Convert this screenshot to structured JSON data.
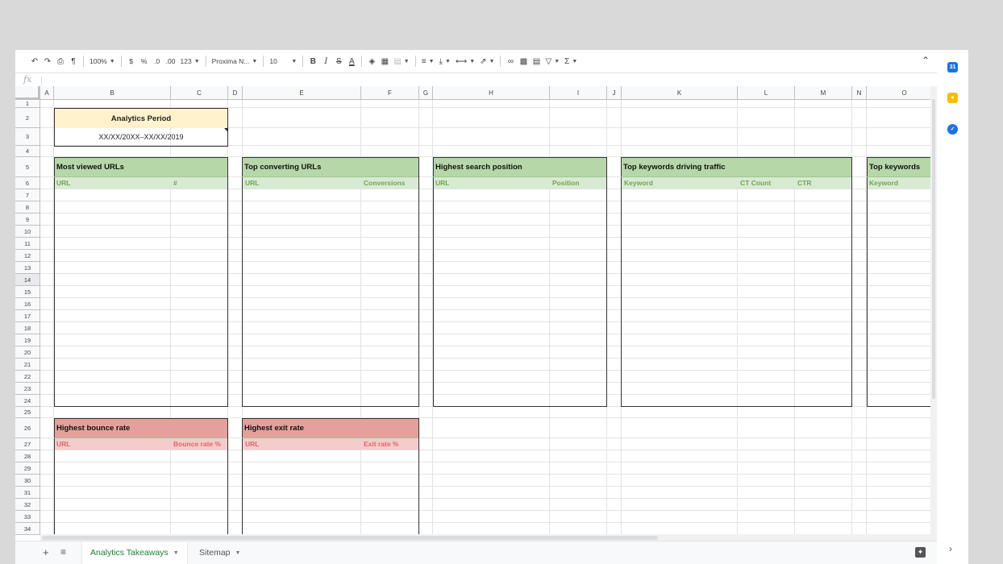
{
  "toolbar": {
    "zoom": "100%",
    "currency": "$",
    "percent": "%",
    "decrease_decimal": ".0",
    "increase_decimal": ".00",
    "more_formats": "123",
    "font": "Proxima N...",
    "font_size": "10",
    "bold": "B",
    "italic": "I",
    "strike": "S",
    "text_color": "A",
    "functions": "Σ"
  },
  "formula_bar": {
    "fx_label": "fx"
  },
  "columns": [
    "A",
    "B",
    "C",
    "D",
    "E",
    "F",
    "G",
    "H",
    "I",
    "J",
    "K",
    "L",
    "M",
    "N",
    "O"
  ],
  "rows": [
    "1",
    "2",
    "3",
    "4",
    "5",
    "6",
    "7",
    "8",
    "9",
    "10",
    "11",
    "12",
    "13",
    "14",
    "15",
    "16",
    "17",
    "18",
    "19",
    "20",
    "21",
    "22",
    "23",
    "24",
    "25",
    "26",
    "27",
    "28",
    "29",
    "30",
    "31",
    "32",
    "33",
    "34"
  ],
  "analytics_period": {
    "title": "Analytics Period",
    "value": "XX/XX/20XX–XX/XX/2019"
  },
  "tables": {
    "most_viewed": {
      "title": "Most viewed URLs",
      "col1": "URL",
      "col2": "#"
    },
    "top_converting": {
      "title": "Top converting URLs",
      "col1": "URL",
      "col2": "Conversions"
    },
    "highest_search": {
      "title": "Highest search position",
      "col1": "URL",
      "col2": "Position"
    },
    "top_keywords_traffic": {
      "title": "Top keywords driving traffic",
      "col1": "Keyword",
      "col2": "CT Count",
      "col3": "CTR"
    },
    "top_keywords": {
      "title": "Top keywords",
      "col1": "Keyword"
    },
    "highest_bounce": {
      "title": "Highest bounce rate",
      "col1": "URL",
      "col2": "Bounce rate %"
    },
    "highest_exit": {
      "title": "Highest exit rate",
      "col1": "URL",
      "col2": "Exit rate %"
    }
  },
  "sheet_tabs": [
    {
      "label": "Analytics Takeaways",
      "active": true
    },
    {
      "label": "Sitemap",
      "active": false
    }
  ],
  "side_panel": {
    "calendar_label": "31"
  },
  "colors": {
    "green_header": "#b6d7a8",
    "green_sub": "#d9ead3",
    "red_header": "#e6a09b",
    "red_sub": "#f4cccc",
    "period_header": "#fff2cc",
    "active_tab_text": "#188038"
  }
}
